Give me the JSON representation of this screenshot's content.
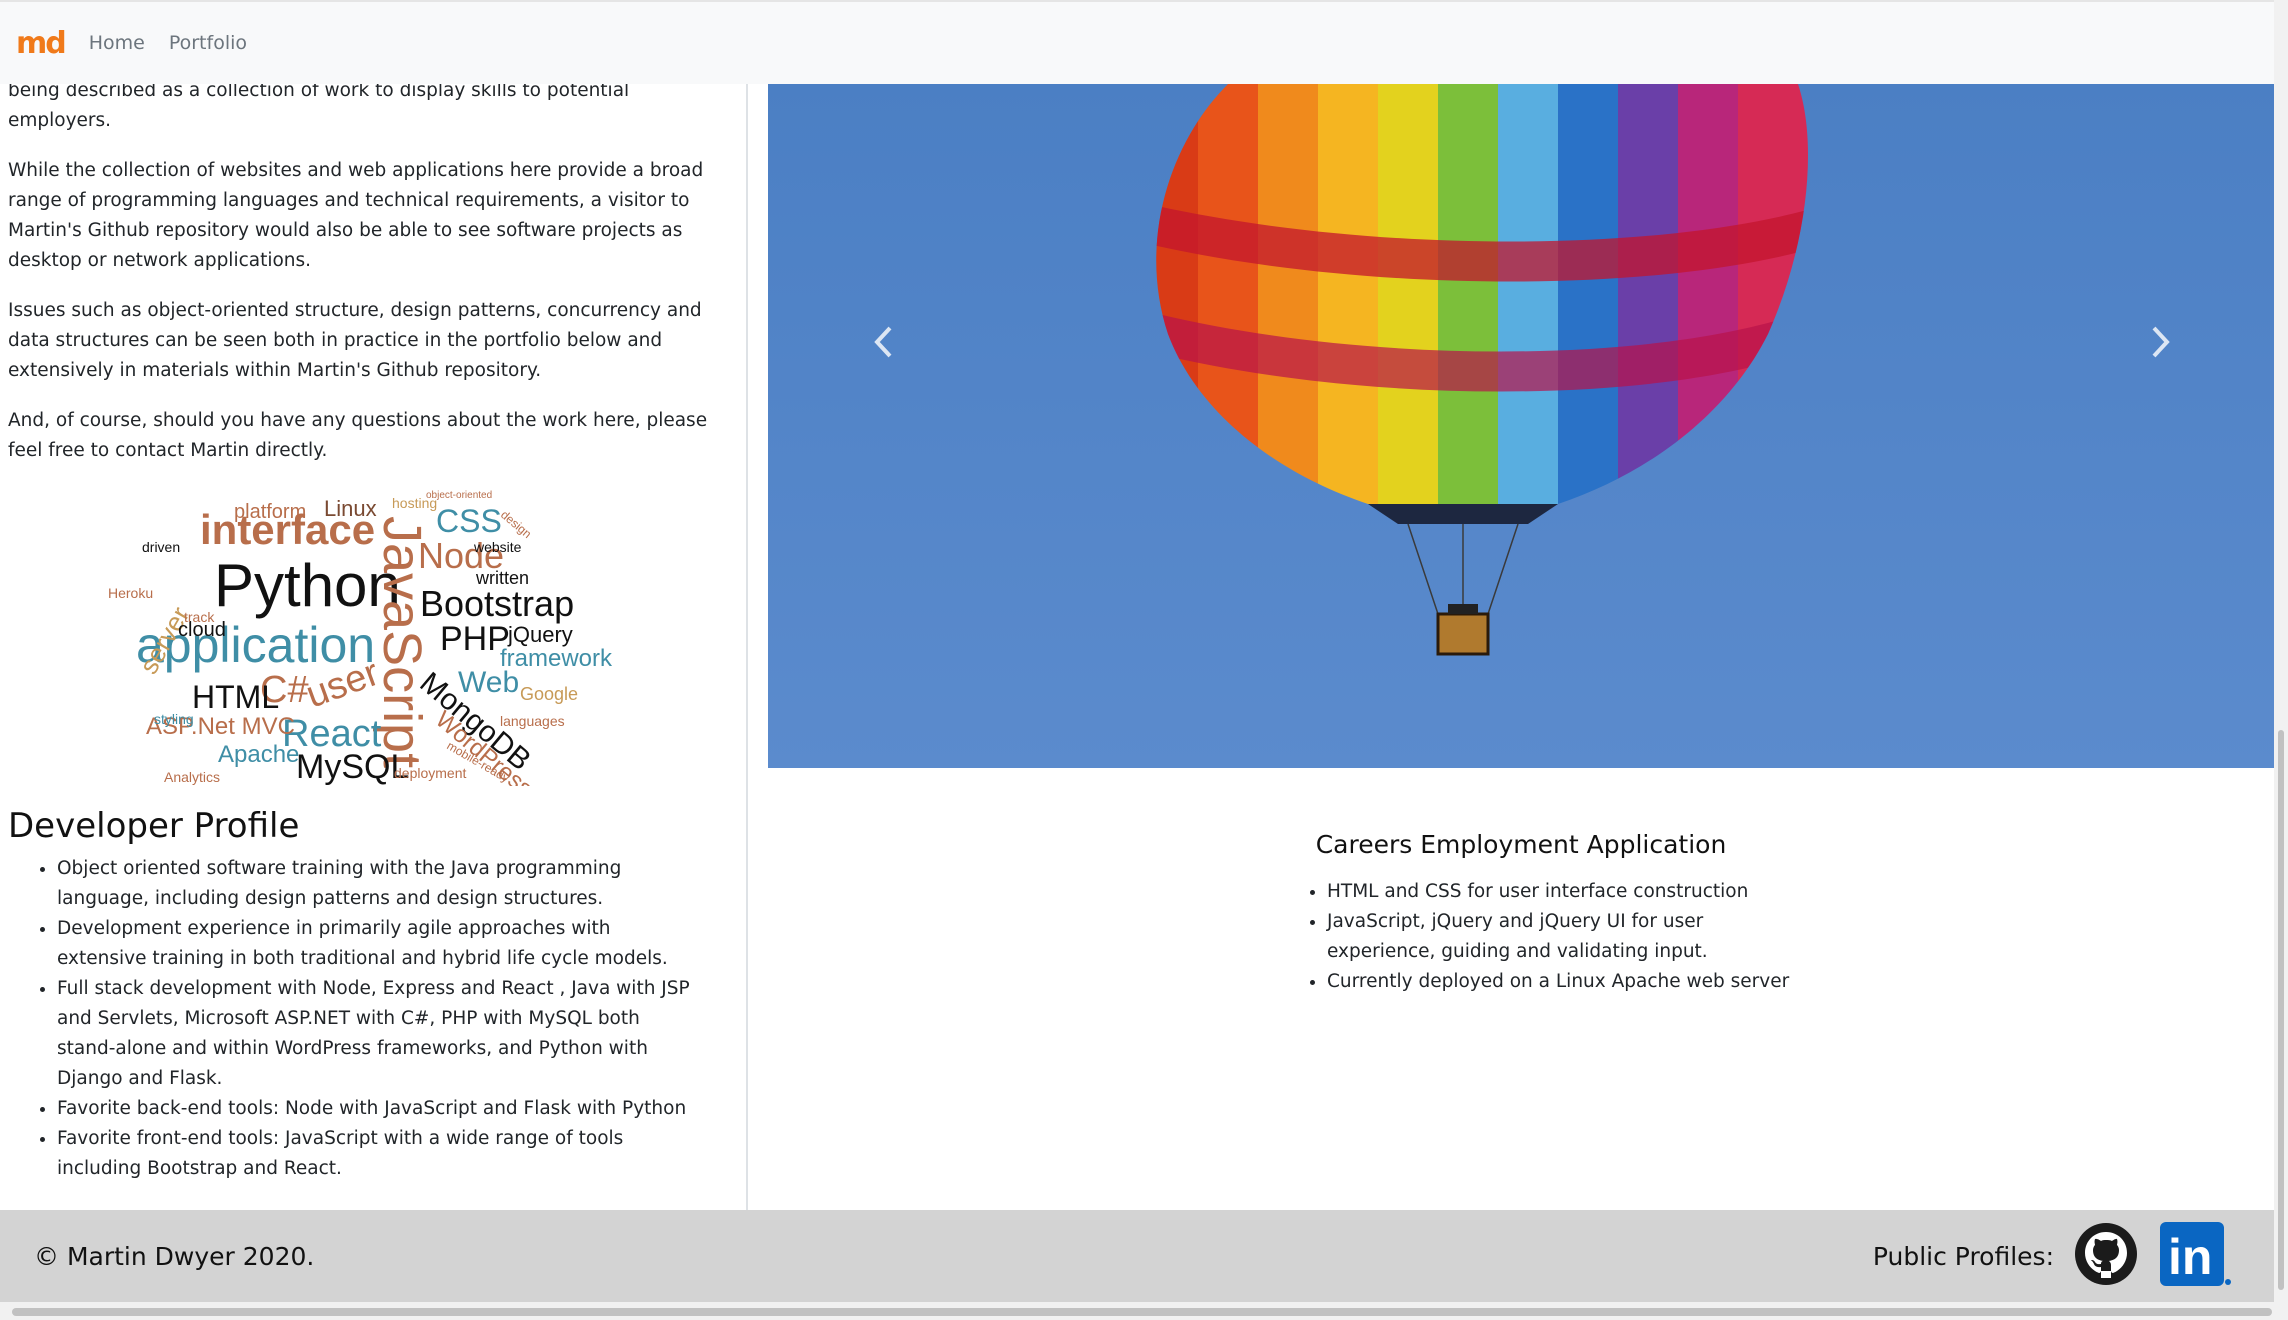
{
  "nav": {
    "brand": "md",
    "links": [
      "Home",
      "Portfolio"
    ]
  },
  "intro": {
    "paragraphs": [
      "being described as a collection of work to display skills to potential employers.",
      "While the collection of websites and web applications here provide a broad range of programming languages and technical requirements, a visitor to Martin's Github repository would also be able to see software projects as desktop or network applications.",
      "Issues such as object-oriented structure, design patterns, concurrency and data structures can be seen both in practice in the portfolio below and extensively in materials within Martin's Github repository.",
      "And, of course, should you have any questions about the work here, please feel free to contact Martin directly."
    ]
  },
  "wordcloud": {
    "words": [
      "interface",
      "Linux",
      "CSS",
      "Node",
      "Python",
      "JavaScript",
      "Bootstrap",
      "application",
      "PHP",
      "jQuery",
      "framework",
      "C#",
      "user",
      "HTML",
      "Web",
      "MongoDB",
      "React",
      "ASP.Net MVC",
      "Apache",
      "MySQL",
      "WordPress",
      "Google",
      "server",
      "cloud",
      "platform",
      "hosting",
      "website",
      "written",
      "styling",
      "Heroku",
      "Analytics",
      "deployment",
      "languages",
      "track",
      "driven",
      "object-oriented",
      "design",
      "mobile-ready"
    ]
  },
  "profile": {
    "title": "Developer Profile",
    "items": [
      "Object oriented software training with the Java programming language, including design patterns and design structures.",
      "Development experience in primarily agile approaches with extensive training in both traditional and hybrid life cycle models.",
      "Full stack development with Node, Express and React , Java with JSP and Servlets, Microsoft ASP.NET with C#, PHP with MySQL both stand-alone and within WordPress frameworks, and Python with Django and Flask.",
      "Favorite back-end tools: Node with JavaScript and Flask with Python",
      "Favorite front-end tools: JavaScript with a wide range of tools including Bootstrap and React."
    ]
  },
  "carousel": {
    "prev_icon": "chevron-left-icon",
    "next_icon": "chevron-right-icon",
    "sky_color": "#4a80c7"
  },
  "project": {
    "title": "Careers Employment Application",
    "items": [
      "HTML and CSS for user interface construction",
      "JavaScript, jQuery and jQuery UI for user experience, guiding and validating input.",
      "Currently deployed on a Linux Apache web server"
    ]
  },
  "footer": {
    "copyright": "© Martin Dwyer 2020.",
    "profiles_label": "Public Profiles:",
    "github_icon": "github-icon",
    "linkedin_icon": "linkedin-icon",
    "linkedin_text": "in"
  },
  "colors": {
    "brand": "#f07a1a",
    "footer_bg": "#d3d3d3",
    "linkedin": "#0a66c2"
  }
}
